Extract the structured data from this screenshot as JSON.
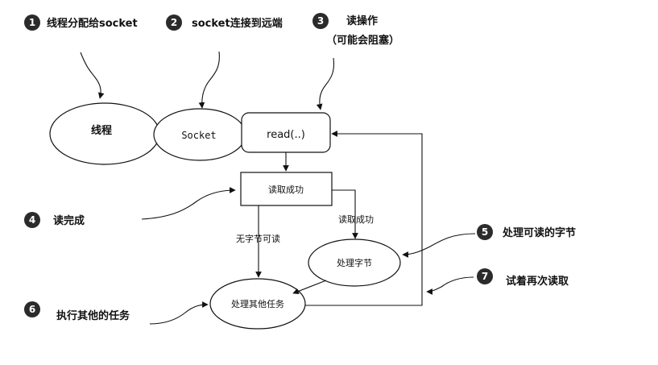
{
  "steps": [
    {
      "num": "1",
      "text": "线程分配给socket"
    },
    {
      "num": "2",
      "text": "socket连接到远端"
    },
    {
      "num": "3",
      "text": "读操作",
      "text2": "（可能会阻塞）"
    },
    {
      "num": "4",
      "text": "读完成"
    },
    {
      "num": "5",
      "text": "处理可读的字节"
    },
    {
      "num": "6",
      "text": "执行其他的任务"
    },
    {
      "num": "7",
      "text": "试着再次读取"
    }
  ],
  "nodes": {
    "thread": "线程",
    "socket": "Socket",
    "read": "read(..)",
    "read_success": "读取成功",
    "process_bytes": "处理字节",
    "other_tasks": "处理其他任务"
  },
  "edges": {
    "no_bytes": "无字节可读",
    "read_success": "读取成功"
  }
}
